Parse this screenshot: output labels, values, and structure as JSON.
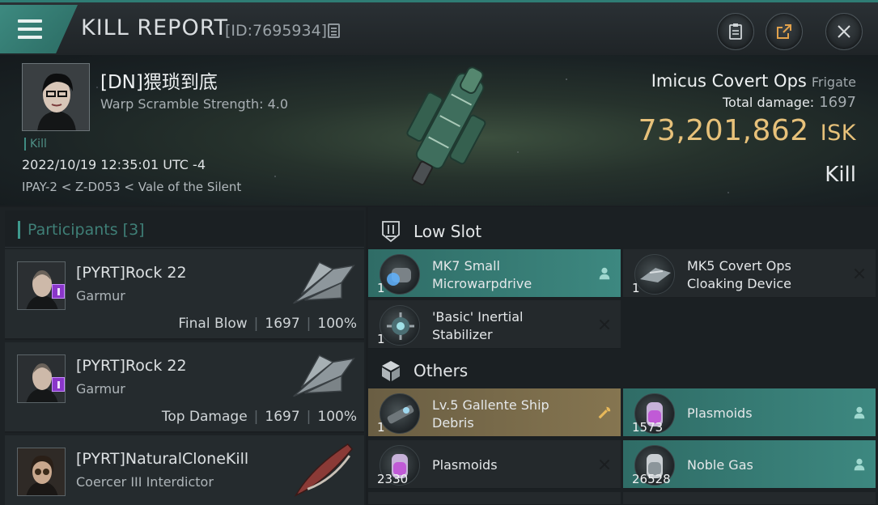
{
  "header": {
    "title": "KILL REPORT",
    "report_id": "[ID:7695934]"
  },
  "victim": {
    "name": "[DN]猥琐到底",
    "warp_scramble": "Warp Scramble Strength: 4.0",
    "tag": "Kill",
    "datetime": "2022/10/19 12:35:01 UTC -4",
    "location": "IPAY-2 < Z-D053 < Vale of the Silent",
    "ship_name": "Imicus Covert Ops",
    "ship_class": "Frigate",
    "damage_label": "Total damage:",
    "damage_value": "1697",
    "isk_value": "73,201,862",
    "isk_unit": "ISK",
    "result": "Kill"
  },
  "participants": {
    "label": "Participants",
    "count": "[3]",
    "items": [
      {
        "name": "[PYRT]Rock 22",
        "ship": "Garmur",
        "role": "Final Blow",
        "damage": "1697",
        "percent": "100%"
      },
      {
        "name": "[PYRT]Rock 22",
        "ship": "Garmur",
        "role": "Top Damage",
        "damage": "1697",
        "percent": "100%"
      },
      {
        "name": "[PYRT]NaturalCloneKill",
        "ship": "Coercer III Interdictor"
      }
    ]
  },
  "modules": {
    "low_slot": {
      "label": "Low Slot",
      "items": [
        {
          "name_line1": "MK7 Small",
          "name_line2": "Microwarpdrive",
          "qty": "1",
          "status": "dropped"
        },
        {
          "name_line1": "MK5 Covert Ops",
          "name_line2": "Cloaking Device",
          "qty": "1",
          "status": "destroyed"
        },
        {
          "name_line1": "'Basic' Inertial",
          "name_line2": "Stabilizer",
          "qty": "1",
          "status": "destroyed"
        }
      ]
    },
    "others": {
      "label": "Others",
      "items": [
        {
          "name_line1": "Lv.5 Gallente Ship",
          "name_line2": "Debris",
          "qty": "1",
          "status": "special"
        },
        {
          "name_line1": "Plasmoids",
          "name_line2": "",
          "qty": "1573",
          "status": "dropped"
        },
        {
          "name_line1": "Plasmoids",
          "name_line2": "",
          "qty": "2330",
          "status": "destroyed"
        },
        {
          "name_line1": "Noble Gas",
          "name_line2": "",
          "qty": "26528",
          "status": "dropped"
        }
      ]
    }
  },
  "colors": {
    "accent_teal": "#3d8880",
    "isk_gold": "#e7c17a",
    "debris_gold": "#857550"
  }
}
